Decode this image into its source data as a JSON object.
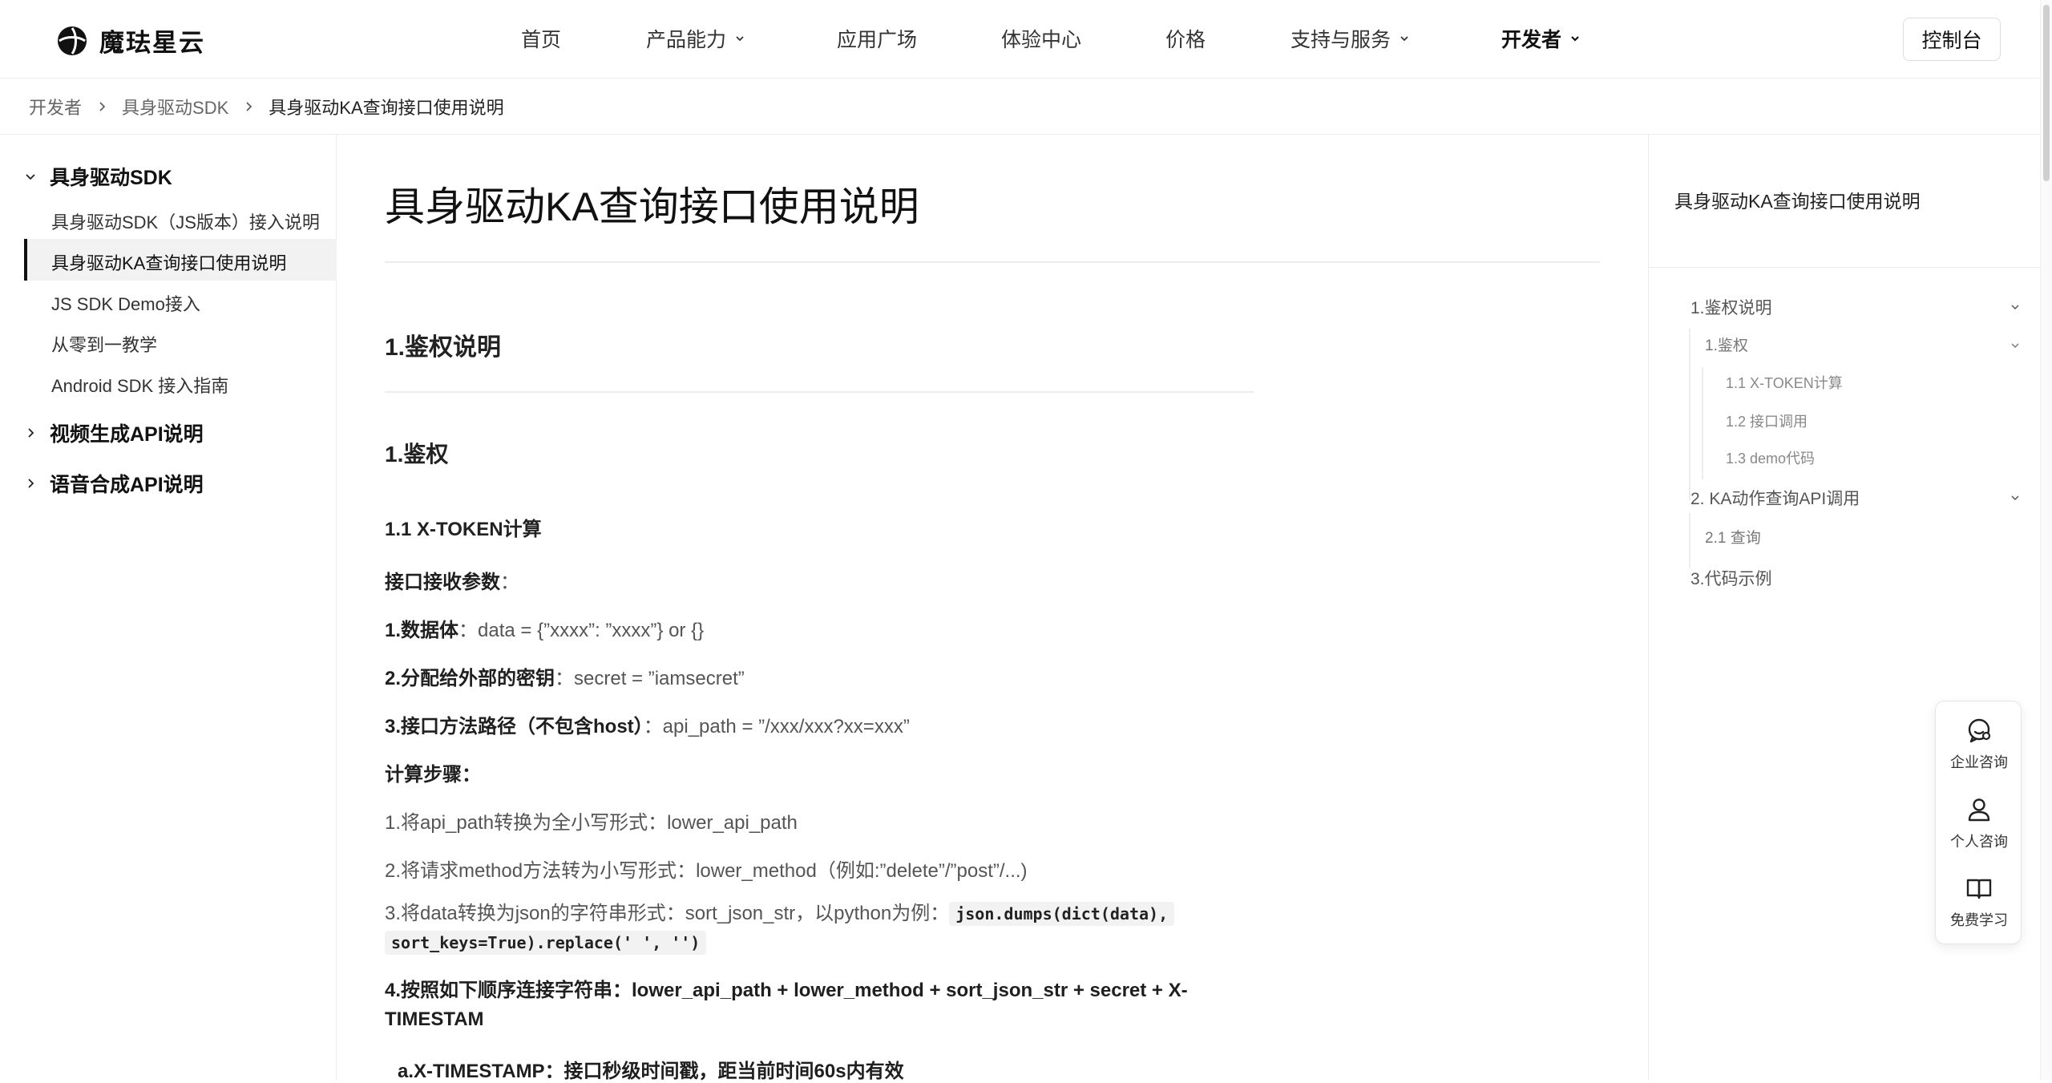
{
  "header": {
    "logo_text": "魔珐星云",
    "nav": [
      {
        "label": "首页"
      },
      {
        "label": "产品能力"
      },
      {
        "label": "应用广场"
      },
      {
        "label": "体验中心"
      },
      {
        "label": "价格"
      },
      {
        "label": "支持与服务"
      },
      {
        "label": "开发者"
      }
    ],
    "console_label": "控制台"
  },
  "breadcrumb": [
    "开发者",
    "具身驱动SDK",
    "具身驱动KA查询接口使用说明"
  ],
  "sidebar": {
    "groups": [
      {
        "label": "具身驱动SDK",
        "items": [
          "具身驱动SDK（JS版本）接入说明",
          "具身驱动KA查询接口使用说明",
          "JS SDK Demo接入",
          "从零到一教学",
          "Android SDK 接入指南"
        ]
      },
      {
        "label": "视频生成API说明"
      },
      {
        "label": "语音合成API说明"
      }
    ]
  },
  "content": {
    "title": "具身驱动KA查询接口使用说明",
    "h2": "1.鉴权说明",
    "h3": "1.鉴权",
    "h4": "1.1 X-TOKEN计算",
    "params_label": "接口接收参数",
    "params_colon": "：",
    "p1_label": "1.数据体",
    "p1_value": "：data = {”xxxx”: ”xxxx”} or {}",
    "p2_label": "2.分配给外部的密钥",
    "p2_value": "：secret = ”iamsecret”",
    "p3_label": "3.接口方法路径（不包含host）",
    "p3_value": "：api_path = ”/xxx/xxx?xx=xxx”",
    "steps_label": "计算步骤：",
    "s1": "1.将api_path转换为全小写形式：lower_api_path",
    "s2": "2.将请求method方法转为小写形式：lower_method（例如:”delete”/”post”/...)",
    "s3_text": "3.将data转换为json的字符串形式：sort_json_str，以python为例：",
    "s3_code1": "json.dumps(dict(data),",
    "s3_code2": "sort_keys=True).replace(' ', '')",
    "s4": "4.按照如下顺序连接字符串：lower_api_path + lower_method + sort_json_str + secret + X-TIMESTAM",
    "s4a": "a.X-TIMESTAMP：接口秒级时间戳，距当前时间60s内有效"
  },
  "toc": {
    "title": "具身驱动KA查询接口使用说明",
    "items": [
      "1.鉴权说明",
      "1.鉴权",
      "1.1 X-TOKEN计算",
      "1.2 接口调用",
      "1.3 demo代码",
      "2. KA动作查询API调用",
      "2.1 查询",
      "3.代码示例"
    ]
  },
  "float_panel": {
    "items": [
      {
        "label": "企业咨询",
        "icon": "chat-icon"
      },
      {
        "label": "个人咨询",
        "icon": "user-icon"
      },
      {
        "label": "免费学习",
        "icon": "book-icon"
      }
    ]
  }
}
